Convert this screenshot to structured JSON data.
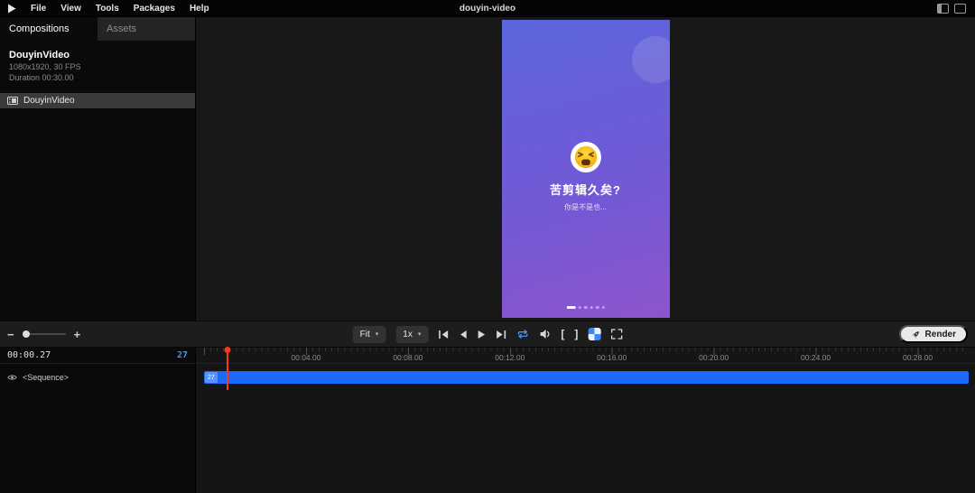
{
  "menu_bar": {
    "title": "douyin-video",
    "items": [
      {
        "label": "File"
      },
      {
        "label": "View"
      },
      {
        "label": "Tools"
      },
      {
        "label": "Packages"
      },
      {
        "label": "Help"
      }
    ]
  },
  "sidebar": {
    "tabs": [
      {
        "label": "Compositions"
      },
      {
        "label": "Assets"
      }
    ],
    "composition": {
      "name": "DouyinVideo",
      "specs": "1080x1920, 30 FPS",
      "duration": "Duration 00:30.00"
    },
    "list": [
      {
        "label": "DouyinVideo"
      }
    ]
  },
  "preview": {
    "heading": "苦剪辑久矣?",
    "subheading": "你是不是也...",
    "colors": {
      "gradient_top": "#5c66db",
      "gradient_bottom": "#8d55cd"
    }
  },
  "toolbar": {
    "fit": "Fit",
    "speed": "1x",
    "zoom_out": "−",
    "zoom_in": "+",
    "chevron": "▾",
    "in_bracket": "[",
    "out_bracket": "]",
    "render": "Render"
  },
  "timeline": {
    "time": "00:00.27",
    "frame": "27",
    "track_name": "<Sequence>",
    "clip_label": "27",
    "ticks": [
      "00:04.00",
      "00:08.00",
      "00:12.00",
      "00:16.00",
      "00:20.00",
      "00:24.00",
      "00:28.00"
    ]
  },
  "colors": {
    "accent_blue": "#4596f7",
    "track_blue": "#1d69fb",
    "playhead_red": "#f5391c"
  }
}
